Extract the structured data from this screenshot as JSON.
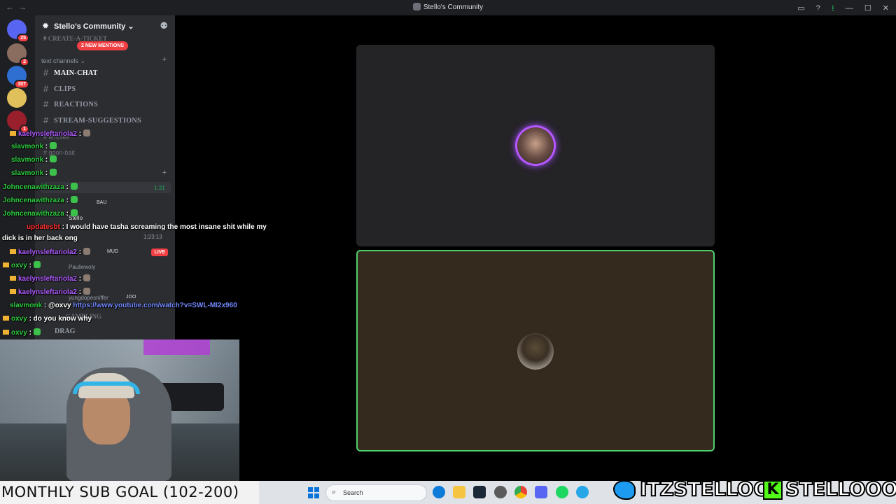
{
  "window": {
    "title": "Stello's Community",
    "nav_back": "←",
    "nav_forward": "→",
    "controls": {
      "inbox": "▭",
      "help": "?",
      "download": "⭳",
      "minimize": "—",
      "maximize": "☐",
      "close": "✕"
    }
  },
  "rail": {
    "home_badge": "25",
    "servers": [
      {
        "badge": "2"
      },
      {
        "badge": "307"
      },
      {
        "badge": ""
      },
      {
        "badge": "1"
      }
    ]
  },
  "server": {
    "name": "Stello's Community",
    "chevron": "⌄",
    "new_mentions": "2 NEW MENTIONS",
    "pinned_channel": "CREATE-A-TICKET",
    "category": "text channels",
    "channels": [
      {
        "name": "MAIN-CHAT",
        "active": true
      },
      {
        "name": "CLIPS",
        "active": false
      },
      {
        "name": "REACTIONS",
        "active": false
      },
      {
        "name": "STREAM-SUGGESTIONS",
        "active": false
      }
    ],
    "dim_channels": [
      "emotes",
      "goon-bait"
    ],
    "voice": {
      "tags": [
        "BAU",
        "MUD",
        "JOO"
      ],
      "users": [
        "Stello",
        "Pauliewoly",
        "yungdopesniffer"
      ],
      "live_label": "LIVE",
      "channels": [
        "GAMBLING",
        "DRAG"
      ]
    }
  },
  "chat": {
    "messages": [
      {
        "user": "kaelynsleftariola2",
        "text": ":",
        "color": "purple"
      },
      {
        "user": "slavmonk",
        "text": ":",
        "color": "green"
      },
      {
        "user": "slavmonk",
        "text": ":",
        "color": "green"
      },
      {
        "user": "slavmonk",
        "text": ":",
        "color": "green"
      },
      {
        "user": "Johncenawithzaza",
        "text": ":",
        "color": "green"
      },
      {
        "user": "Johncenawithzaza",
        "text": ":",
        "color": "green"
      },
      {
        "user": "Johncenawithzaza",
        "text": ":",
        "color": "green"
      },
      {
        "user": "updatesbt",
        "text": ": I would have tasha screaming the most insane shit while my",
        "color": "red"
      },
      {
        "user": "",
        "text": "dick is in her back ong",
        "color": "green"
      },
      {
        "user": "kaelynsleftariola2",
        "text": ":",
        "color": "purple"
      },
      {
        "user": "oxvy",
        "text": ":",
        "color": "green"
      },
      {
        "user": "kaelynsleftariola2",
        "text": ":",
        "color": "purple"
      },
      {
        "user": "kaelynsleftariola2",
        "text": ":",
        "color": "purple"
      },
      {
        "user": "slavmonk",
        "text": ": @oxvy",
        "link": "https://www.youtube.com/watch?v=SWL-MI2x960",
        "color": "green"
      },
      {
        "user": "oxvy",
        "text": ": do you know why",
        "color": "green"
      },
      {
        "user": "oxvy",
        "text": ":",
        "color": "green"
      }
    ],
    "timestamps": [
      "1:31",
      "1:23:13"
    ]
  },
  "overlay": {
    "sub_goal": "MONTHLY SUB GOAL (102-200)",
    "twitter_handle": "ITZSTELLOO",
    "kick_letter": "K",
    "kick_handle": "STELLOOO"
  },
  "taskbar": {
    "search_placeholder": "Search",
    "search_icon": "⌕"
  },
  "colors": {
    "speaking_ring": "#4fd06a",
    "active_avatar_ring": "#b658ff",
    "badge_red": "#f23f43",
    "kick_green": "#53fc18",
    "twitter_blue": "#1d9bf0"
  }
}
